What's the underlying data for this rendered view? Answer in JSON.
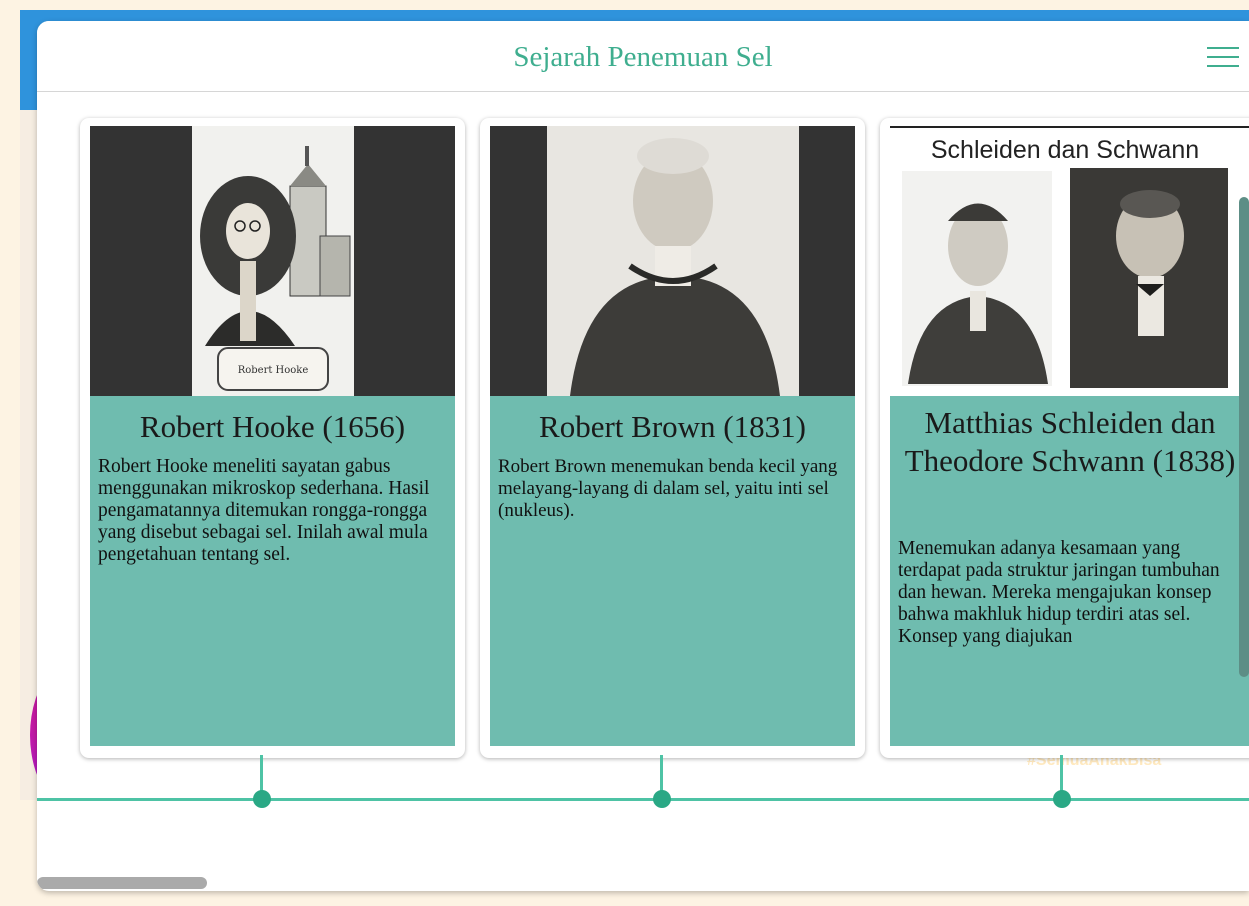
{
  "header": {
    "title": "Sejarah Penemuan Sel",
    "menu_icon": "hamburger-menu-icon"
  },
  "cards": [
    {
      "title": "Robert Hooke (1656)",
      "text": "Robert Hooke meneliti sayatan gabus menggunakan mikroskop sederhana. Hasil pengamatannya ditemukan rongga-rongga yang disebut sebagai sel. Inilah awal mula pengetahuan tentang sel.",
      "image_caption": "Robert Hooke"
    },
    {
      "title": "Robert Brown (1831)",
      "text": "Robert Brown menemukan benda kecil yang melayang-layang di dalam sel, yaitu inti sel (nukleus)."
    },
    {
      "title": "Matthias Schleiden dan Theodore Schwann (1838)",
      "text": "Menemukan adanya kesamaan yang terdapat pada struktur jaringan tumbuhan dan hewan. Mereka mengajukan konsep bahwa makhluk hidup terdiri atas sel. Konsep yang diajukan",
      "image_heading": "Schleiden dan Schwann"
    }
  ],
  "background": {
    "hashtag": "#SemuaAnakBisa"
  },
  "colors": {
    "accent": "#3fae8f",
    "card_body": "#6fbcaf",
    "timeline": "#4ec3a5"
  }
}
